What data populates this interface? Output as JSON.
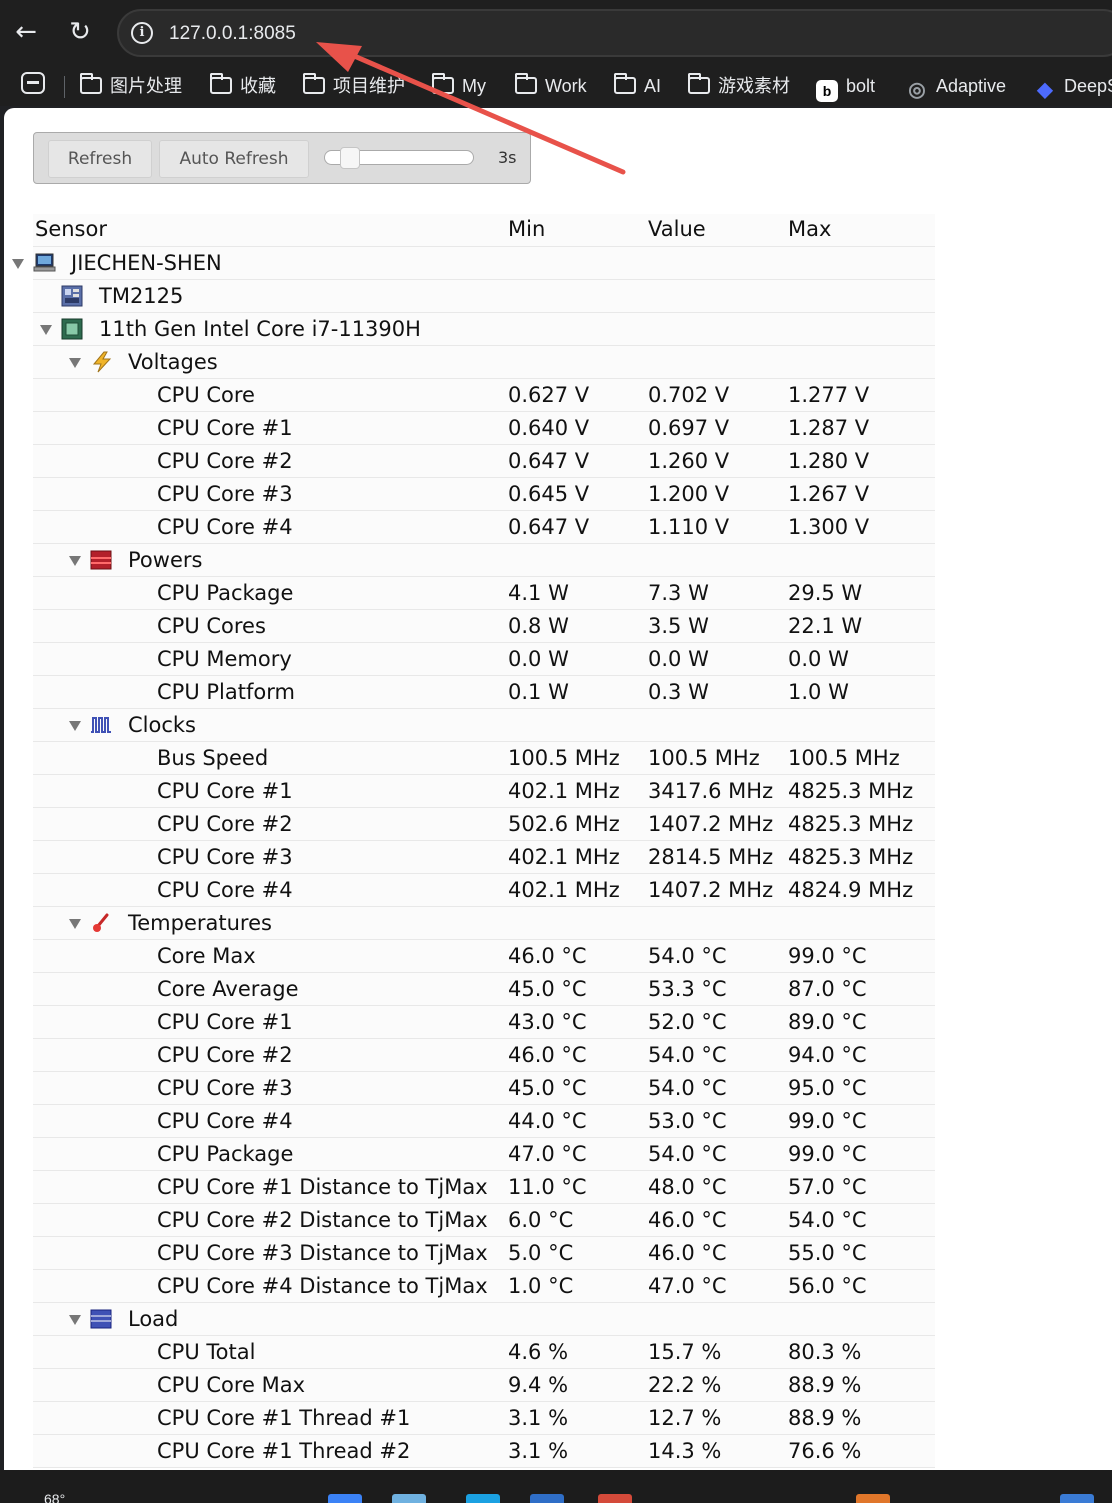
{
  "browser": {
    "url": "127.0.0.1:8085",
    "back_icon": "←",
    "reload_icon": "↻",
    "info_icon": "i",
    "bookmarks": [
      {
        "label": "图片处理",
        "icon": "folder-icon"
      },
      {
        "label": "收藏",
        "icon": "folder-icon"
      },
      {
        "label": "项目维护",
        "icon": "folder-icon"
      },
      {
        "label": "My",
        "icon": "folder-icon"
      },
      {
        "label": "Work",
        "icon": "folder-icon"
      },
      {
        "label": "AI",
        "icon": "folder-icon"
      },
      {
        "label": "游戏素材",
        "icon": "folder-icon"
      },
      {
        "label": "bolt",
        "icon": "bolt-logo-icon",
        "logo_text": "b",
        "color": "#ffffff"
      },
      {
        "label": "Adaptive",
        "icon": "adaptive-logo-icon",
        "logo_text": "◎",
        "color": "#9aa0a6"
      },
      {
        "label": "DeepSeek",
        "icon": "deepseek-logo-icon",
        "logo_text": "◆",
        "color": "#4d6bfe"
      }
    ]
  },
  "toolbar": {
    "refresh_label": "Refresh",
    "auto_refresh_label": "Auto Refresh",
    "interval": 0.1,
    "interval_label": "3s"
  },
  "table": {
    "headers": {
      "sensor": "Sensor",
      "min": "Min",
      "value": "Value",
      "max": "Max"
    },
    "rows": [
      {
        "name": "JIECHEN-SHEN",
        "level": 0,
        "expandable": true,
        "icon": "computer-icon"
      },
      {
        "name": "TM2125",
        "level": 1,
        "expandable": false,
        "icon": "motherboard-icon"
      },
      {
        "name": "11th Gen Intel Core i7-11390H",
        "level": 1,
        "expandable": true,
        "icon": "cpu-icon"
      },
      {
        "name": "Voltages",
        "level": 2,
        "expandable": true,
        "icon": "voltage-icon"
      },
      {
        "name": "CPU Core",
        "level": 3,
        "min": "0.627 V",
        "value": "0.702 V",
        "max": "1.277 V"
      },
      {
        "name": "CPU Core #1",
        "level": 3,
        "min": "0.640 V",
        "value": "0.697 V",
        "max": "1.287 V"
      },
      {
        "name": "CPU Core #2",
        "level": 3,
        "min": "0.647 V",
        "value": "1.260 V",
        "max": "1.280 V"
      },
      {
        "name": "CPU Core #3",
        "level": 3,
        "min": "0.645 V",
        "value": "1.200 V",
        "max": "1.267 V"
      },
      {
        "name": "CPU Core #4",
        "level": 3,
        "min": "0.647 V",
        "value": "1.110 V",
        "max": "1.300 V"
      },
      {
        "name": "Powers",
        "level": 2,
        "expandable": true,
        "icon": "power-icon"
      },
      {
        "name": "CPU Package",
        "level": 3,
        "min": "4.1 W",
        "value": "7.3 W",
        "max": "29.5 W"
      },
      {
        "name": "CPU Cores",
        "level": 3,
        "min": "0.8 W",
        "value": "3.5 W",
        "max": "22.1 W"
      },
      {
        "name": "CPU Memory",
        "level": 3,
        "min": "0.0 W",
        "value": "0.0 W",
        "max": "0.0 W"
      },
      {
        "name": "CPU Platform",
        "level": 3,
        "min": "0.1 W",
        "value": "0.3 W",
        "max": "1.0 W"
      },
      {
        "name": "Clocks",
        "level": 2,
        "expandable": true,
        "icon": "clock-icon"
      },
      {
        "name": "Bus Speed",
        "level": 3,
        "min": "100.5 MHz",
        "value": "100.5 MHz",
        "max": "100.5 MHz"
      },
      {
        "name": "CPU Core #1",
        "level": 3,
        "min": "402.1 MHz",
        "value": "3417.6 MHz",
        "max": "4825.3 MHz"
      },
      {
        "name": "CPU Core #2",
        "level": 3,
        "min": "502.6 MHz",
        "value": "1407.2 MHz",
        "max": "4825.3 MHz"
      },
      {
        "name": "CPU Core #3",
        "level": 3,
        "min": "402.1 MHz",
        "value": "2814.5 MHz",
        "max": "4825.3 MHz"
      },
      {
        "name": "CPU Core #4",
        "level": 3,
        "min": "402.1 MHz",
        "value": "1407.2 MHz",
        "max": "4824.9 MHz"
      },
      {
        "name": "Temperatures",
        "level": 2,
        "expandable": true,
        "icon": "thermometer-icon"
      },
      {
        "name": "Core Max",
        "level": 3,
        "min": "46.0 °C",
        "value": "54.0 °C",
        "max": "99.0 °C"
      },
      {
        "name": "Core Average",
        "level": 3,
        "min": "45.0 °C",
        "value": "53.3 °C",
        "max": "87.0 °C"
      },
      {
        "name": "CPU Core #1",
        "level": 3,
        "min": "43.0 °C",
        "value": "52.0 °C",
        "max": "89.0 °C"
      },
      {
        "name": "CPU Core #2",
        "level": 3,
        "min": "46.0 °C",
        "value": "54.0 °C",
        "max": "94.0 °C"
      },
      {
        "name": "CPU Core #3",
        "level": 3,
        "min": "45.0 °C",
        "value": "54.0 °C",
        "max": "95.0 °C"
      },
      {
        "name": "CPU Core #4",
        "level": 3,
        "min": "44.0 °C",
        "value": "53.0 °C",
        "max": "99.0 °C"
      },
      {
        "name": "CPU Package",
        "level": 3,
        "min": "47.0 °C",
        "value": "54.0 °C",
        "max": "99.0 °C"
      },
      {
        "name": "CPU Core #1 Distance to TjMax",
        "level": 3,
        "min": "11.0 °C",
        "value": "48.0 °C",
        "max": "57.0 °C"
      },
      {
        "name": "CPU Core #2 Distance to TjMax",
        "level": 3,
        "min": "6.0 °C",
        "value": "46.0 °C",
        "max": "54.0 °C"
      },
      {
        "name": "CPU Core #3 Distance to TjMax",
        "level": 3,
        "min": "5.0 °C",
        "value": "46.0 °C",
        "max": "55.0 °C"
      },
      {
        "name": "CPU Core #4 Distance to TjMax",
        "level": 3,
        "min": "1.0 °C",
        "value": "47.0 °C",
        "max": "56.0 °C"
      },
      {
        "name": "Load",
        "level": 2,
        "expandable": true,
        "icon": "load-icon"
      },
      {
        "name": "CPU Total",
        "level": 3,
        "min": "4.6 %",
        "value": "15.7 %",
        "max": "80.3 %"
      },
      {
        "name": "CPU Core Max",
        "level": 3,
        "min": "9.4 %",
        "value": "22.2 %",
        "max": "88.9 %"
      },
      {
        "name": "CPU Core #1 Thread #1",
        "level": 3,
        "min": "3.1 %",
        "value": "12.7 %",
        "max": "88.9 %"
      },
      {
        "name": "CPU Core #1 Thread #2",
        "level": 3,
        "min": "3.1 %",
        "value": "14.3 %",
        "max": "76.6 %"
      }
    ]
  },
  "taskbar": {
    "temperature": "68°"
  },
  "colors": {
    "annotation_arrow": "#e8524a"
  }
}
